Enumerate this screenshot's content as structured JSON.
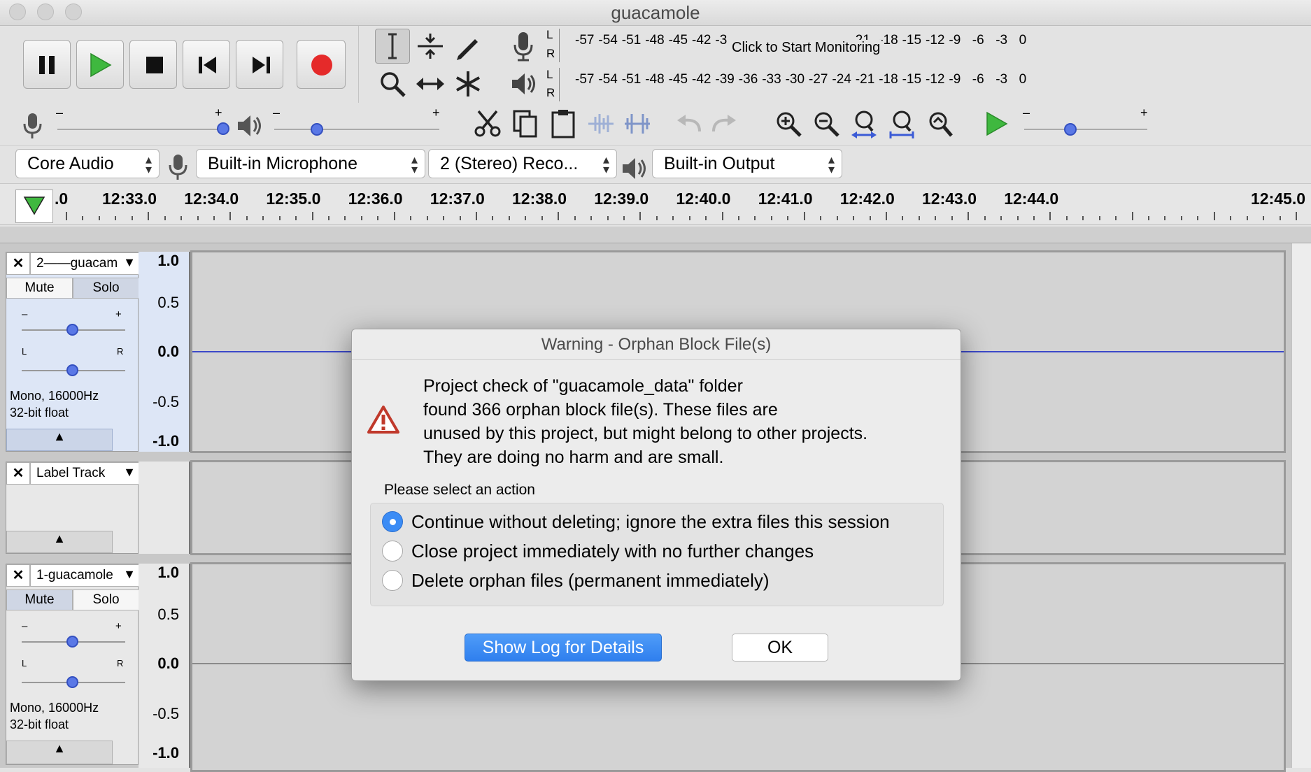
{
  "window": {
    "title": "guacamole"
  },
  "meters": {
    "record_scale": [
      "-57",
      "-54",
      "-51",
      "-48",
      "-45",
      "-42",
      "-3",
      "21",
      "-18",
      "-15",
      "-12",
      "-9",
      "-6",
      "-3",
      "0"
    ],
    "record_monitor_text": "Click to Start Monitoring",
    "play_scale": [
      "-57",
      "-54",
      "-51",
      "-48",
      "-45",
      "-42",
      "-39",
      "-36",
      "-33",
      "-30",
      "-27",
      "-24",
      "-21",
      "-18",
      "-15",
      "-12",
      "-9",
      "-6",
      "-3",
      "0"
    ],
    "channel_l": "L",
    "channel_r": "R"
  },
  "mixer": {
    "minus": "–",
    "plus": "+"
  },
  "devices": {
    "host": "Core Audio",
    "input": "Built-in Microphone",
    "channels": "2 (Stereo) Reco...",
    "output": "Built-in Output"
  },
  "ruler": {
    "ticks": [
      ".0",
      "12:33.0",
      "12:34.0",
      "12:35.0",
      "12:36.0",
      "12:37.0",
      "12:38.0",
      "12:39.0",
      "12:40.0",
      "12:41.0",
      "12:42.0",
      "12:43.0",
      "12:44.0",
      "12:45.0"
    ]
  },
  "tracks": [
    {
      "name": "2——guacam",
      "mute": "Mute",
      "solo": "Solo",
      "info1": "Mono, 16000Hz",
      "info2": "32-bit float",
      "gain_minus": "–",
      "gain_plus": "+",
      "pan_l": "L",
      "pan_r": "R",
      "scale": [
        "1.0",
        "0.5",
        "0.0",
        "-0.5",
        "-1.0"
      ]
    },
    {
      "name": "Label Track"
    },
    {
      "name": "1-guacamole",
      "mute": "Mute",
      "solo": "Solo",
      "info1": "Mono, 16000Hz",
      "info2": "32-bit float",
      "gain_minus": "–",
      "gain_plus": "+",
      "pan_l": "L",
      "pan_r": "R",
      "scale": [
        "1.0",
        "0.5",
        "0.0",
        "-0.5",
        "-1.0"
      ]
    }
  ],
  "dialog": {
    "title": "Warning - Orphan Block File(s)",
    "message_lines": [
      "Project check of \"guacamole_data\" folder",
      "found 366 orphan block file(s). These files are",
      "unused by this project, but might belong to other projects.",
      "They are doing no harm and are small."
    ],
    "prompt": "Please select an action",
    "options": [
      "Continue without deleting; ignore the extra files this session",
      "Close project immediately with no further changes",
      "Delete orphan files (permanent immediately)"
    ],
    "selected_option": 0,
    "log_button": "Show Log for Details",
    "ok_button": "OK"
  },
  "colors": {
    "accent": "#3b8cf5",
    "record": "#e52a2a",
    "play": "#3fb83f",
    "wave_line": "#3b48c9"
  }
}
